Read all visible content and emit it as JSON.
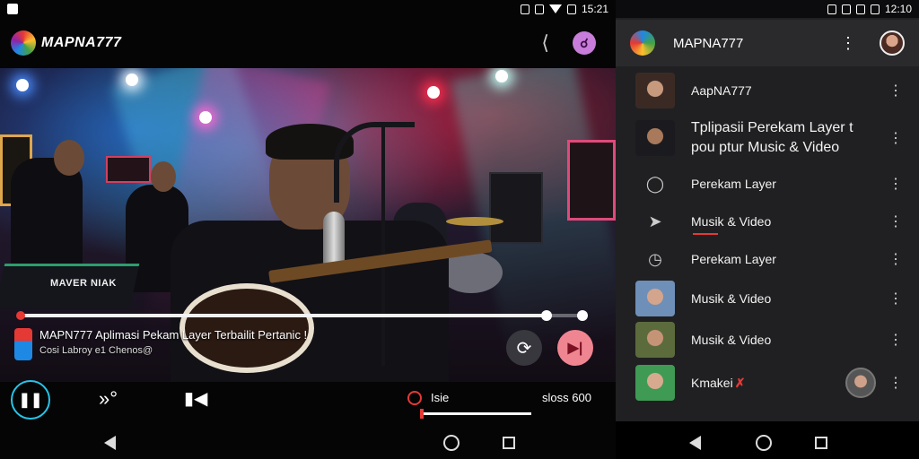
{
  "left_status": {
    "time": "15:21"
  },
  "right_status": {
    "time": "12:10"
  },
  "app": {
    "brand": "MAPNA777"
  },
  "video": {
    "mixer_label": "MAVER NIAK",
    "title": "MAPN777 Aplimasi Pekam Layer Terbailit Pertanic !",
    "subtitle": "Cosi Labroy e1 Chenos@",
    "progress": 0.935
  },
  "controls": {
    "label": "Isie",
    "time": "sloss 600",
    "volume": 0.02
  },
  "sidebar": {
    "brand": "MAPNA777",
    "items": [
      {
        "label": "AapNA777",
        "thumb": "face-thumb"
      },
      {
        "label": "Tplipasii Perekam Layer t\npou ptur Music & Video",
        "thumb": "face-thumb"
      },
      {
        "label": "Perekam Layer",
        "icon": "chat-icon"
      },
      {
        "label": "Musik & Video",
        "icon": "share-icon"
      },
      {
        "label": "Perekam Layer",
        "icon": "timer-icon"
      },
      {
        "label": "Musik & Video",
        "thumb": "face-thumb"
      },
      {
        "label": "Musik & Video",
        "thumb": "face-thumb"
      },
      {
        "label": "Kmakei",
        "thumb": "face-thumb"
      }
    ]
  },
  "colors": {
    "accent": "#e53935",
    "play_ring": "#27c4e8",
    "next_button": "#f08592"
  }
}
